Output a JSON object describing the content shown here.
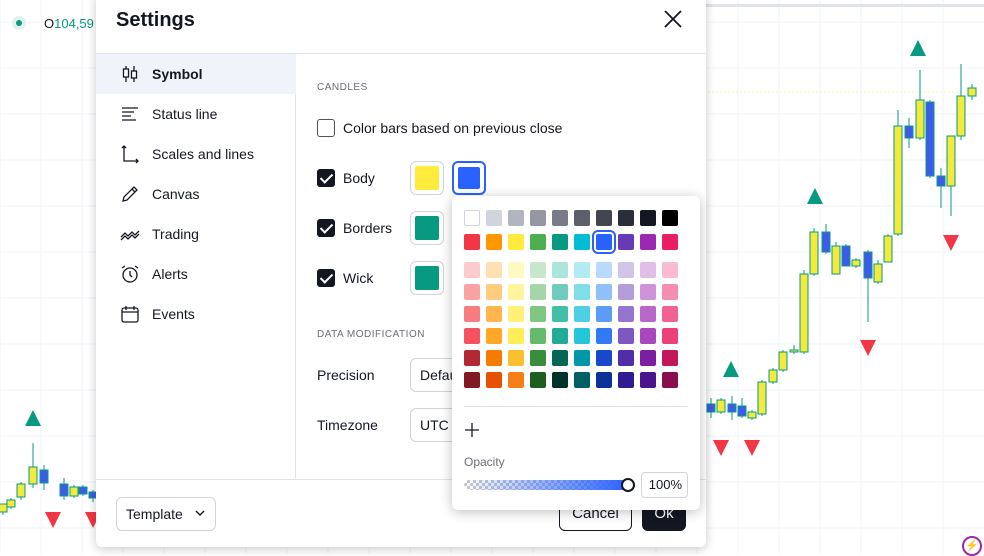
{
  "chart": {
    "legend_open_label": "O",
    "legend_open_value": "104,59",
    "colors": {
      "up": "#f2ea3c",
      "down": "#3d5bea",
      "wick": "#089981",
      "marker_up": "#089981",
      "marker_down": "#f23645",
      "grid": "#f0f3fa"
    },
    "flash_icon": "lightning-icon"
  },
  "dialog": {
    "title": "Settings",
    "close_icon": "close-icon",
    "sidebar": [
      {
        "label": "Symbol",
        "icon": "candlestick-icon",
        "active": true
      },
      {
        "label": "Status line",
        "icon": "status-line-icon",
        "active": false
      },
      {
        "label": "Scales and lines",
        "icon": "scales-icon",
        "active": false
      },
      {
        "label": "Canvas",
        "icon": "pencil-icon",
        "active": false
      },
      {
        "label": "Trading",
        "icon": "trading-icon",
        "active": false
      },
      {
        "label": "Alerts",
        "icon": "alarm-clock-icon",
        "active": false
      },
      {
        "label": "Events",
        "icon": "calendar-icon",
        "active": false
      }
    ],
    "candles": {
      "section_title": "CANDLES",
      "color_bars_label": "Color bars based on previous close",
      "color_bars_checked": false,
      "body": {
        "label": "Body",
        "checked": true,
        "up_color": "#ffeb3b",
        "down_color": "#2962ff"
      },
      "borders": {
        "label": "Borders",
        "checked": true,
        "color": "#089981"
      },
      "wick": {
        "label": "Wick",
        "checked": true,
        "color": "#089981"
      }
    },
    "data_modification": {
      "section_title": "DATA MODIFICATION",
      "precision_label": "Precision",
      "precision_value": "Default",
      "timezone_label": "Timezone",
      "timezone_value": "UTC"
    },
    "footer": {
      "template_label": "Template",
      "cancel_label": "Cancel",
      "ok_label": "Ok"
    }
  },
  "color_picker": {
    "grays": [
      "#ffffff",
      "#d1d4dc",
      "#b2b5be",
      "#9598a1",
      "#787b86",
      "#5d606b",
      "#434651",
      "#2a2e39",
      "#131722",
      "#000000"
    ],
    "primaries": [
      "#f23645",
      "#ff9800",
      "#ffeb3b",
      "#4caf50",
      "#089981",
      "#00bcd4",
      "#2962ff",
      "#673ab7",
      "#9c27b0",
      "#e91e63"
    ],
    "shades": [
      [
        "#fccbcd",
        "#ffe0b2",
        "#fff9c4",
        "#c8e6c9",
        "#ace5dc",
        "#b2ebf2",
        "#bbd9fb",
        "#d1c4e9",
        "#e1bee7",
        "#f8bbd0"
      ],
      [
        "#faa1a4",
        "#ffcc80",
        "#fff59d",
        "#a5d6a7",
        "#70ccbd",
        "#80deea",
        "#90bff9",
        "#b39ddb",
        "#ce93d8",
        "#f48fb1"
      ],
      [
        "#f77c80",
        "#ffb74d",
        "#fff176",
        "#81c784",
        "#42bda8",
        "#4dd0e1",
        "#5b9cf6",
        "#9575cd",
        "#ba68c8",
        "#f06292"
      ],
      [
        "#f7525f",
        "#ffa726",
        "#ffee58",
        "#66bb6a",
        "#22ab94",
        "#26c6da",
        "#3179f5",
        "#7e57c2",
        "#ab47bc",
        "#ec407a"
      ],
      [
        "#b22833",
        "#f57c00",
        "#fbc02d",
        "#388e3c",
        "#056656",
        "#0097a7",
        "#1848cc",
        "#512da8",
        "#7b1fa2",
        "#c2185b"
      ],
      [
        "#801922",
        "#e65100",
        "#f57f17",
        "#1b5e20",
        "#00332a",
        "#006064",
        "#0c3299",
        "#311b92",
        "#4a148c",
        "#880e4f"
      ]
    ],
    "selected_color": "#2962ff",
    "add_icon": "plus-icon",
    "opacity_label": "Opacity",
    "opacity_fraction": 1.0,
    "opacity_value": "100%"
  }
}
